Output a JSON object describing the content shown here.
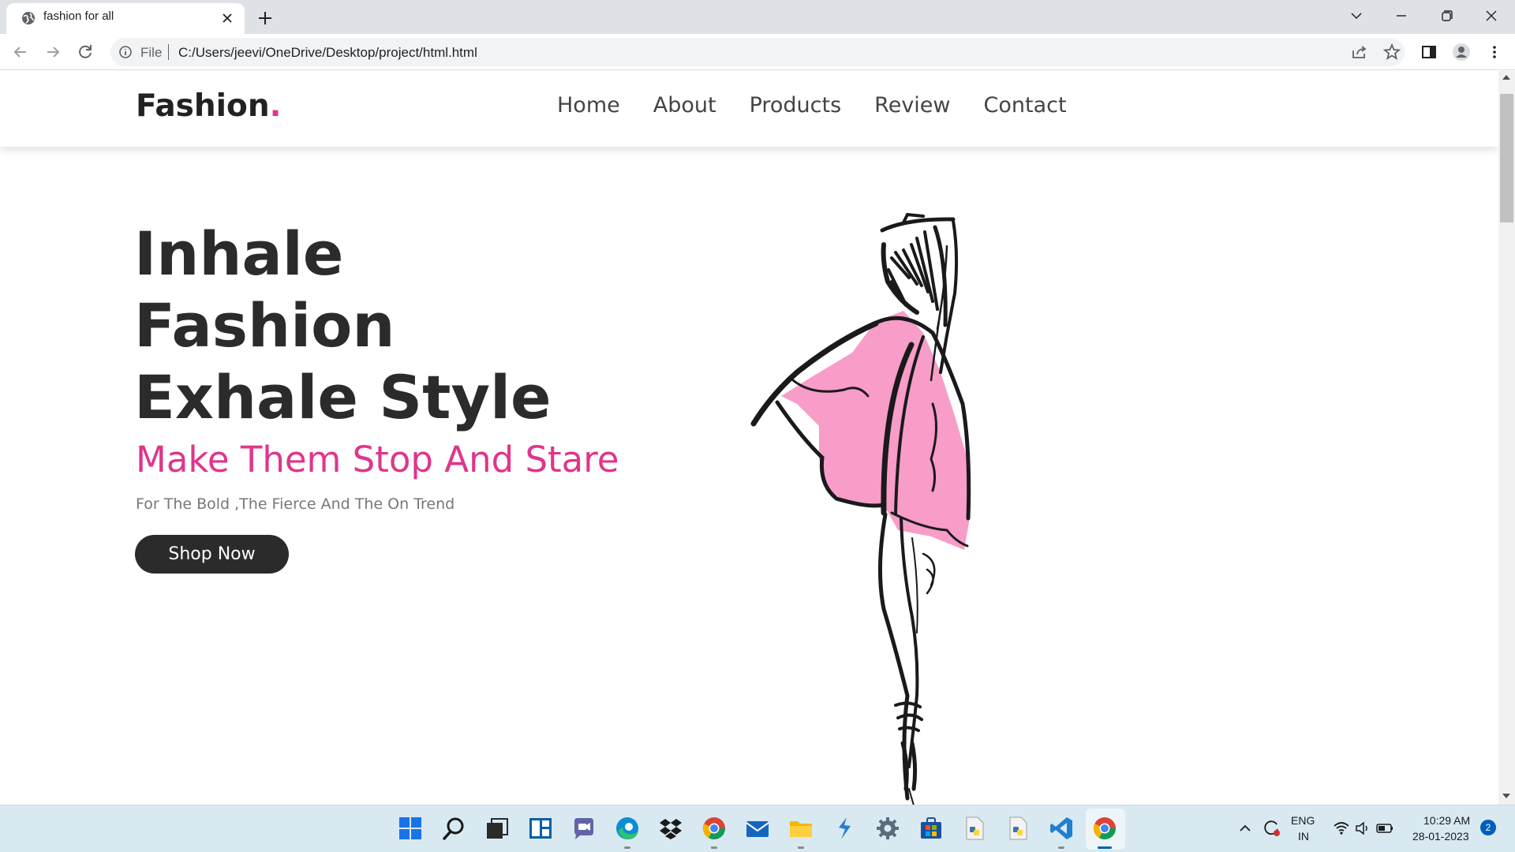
{
  "browser": {
    "tab": {
      "title": "fashion for all",
      "favicon": "globe-icon"
    },
    "address_bar": {
      "scheme_label": "File",
      "url": "C:/Users/jeevi/OneDrive/Desktop/project/html.html"
    }
  },
  "site": {
    "logo": {
      "text": "Fashion",
      "dot": "."
    },
    "nav": [
      {
        "label": "Home"
      },
      {
        "label": "About"
      },
      {
        "label": "Products"
      },
      {
        "label": "Review"
      },
      {
        "label": "Contact"
      }
    ],
    "hero": {
      "title_lines": [
        "Inhale",
        "Fashion",
        "Exhale Style"
      ],
      "subtitle": "Make Them Stop And Stare",
      "description": "For The Bold ,The Fierce And The On Trend",
      "cta_label": "Shop Now"
    },
    "colors": {
      "accent": "#e0358a",
      "dark": "#2b2b2b",
      "dress_pink": "#f89cc8"
    }
  },
  "taskbar": {
    "apps": [
      "windows-start",
      "search",
      "task-view",
      "widgets",
      "teams-chat",
      "edge",
      "dropbox",
      "chrome",
      "mail",
      "file-explorer",
      "vs-app",
      "settings",
      "store",
      "python-file",
      "python-file",
      "vscode",
      "chrome"
    ],
    "tray": {
      "language_top": "ENG",
      "language_bottom": "IN",
      "time": "10:29 AM",
      "date": "28-01-2023",
      "notification_count": "2"
    }
  }
}
